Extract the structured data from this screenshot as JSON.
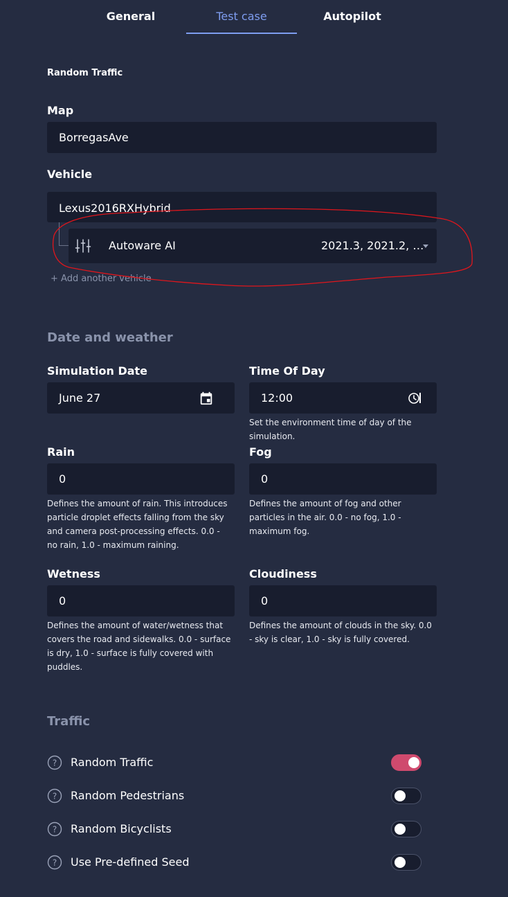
{
  "tabs": [
    "General",
    "Test case",
    "Autopilot"
  ],
  "active_tab": "Test case",
  "random_traffic_title": "Random Traffic",
  "map": {
    "label": "Map",
    "value": "BorregasAve"
  },
  "vehicle": {
    "label": "Vehicle",
    "value": "Lexus2016RXHybrid",
    "sensor": {
      "name": "Autoware AI",
      "versions": "2021.3, 2021.2, 20..."
    },
    "add_label": "+ Add another vehicle"
  },
  "date_weather": {
    "title": "Date and weather",
    "simulation_date": {
      "label": "Simulation Date",
      "value": "June 27"
    },
    "time_of_day": {
      "label": "Time Of Day",
      "value": "12:00",
      "help": "Set the environment time of day of the simulation."
    },
    "rain": {
      "label": "Rain",
      "value": "0",
      "help": "Defines the amount of rain. This introduces particle droplet effects falling from the sky and camera post-processing effects. 0.0 - no rain, 1.0 - maximum raining."
    },
    "fog": {
      "label": "Fog",
      "value": "0",
      "help": "Defines the amount of fog and other particles in the air. 0.0 - no fog, 1.0 - maximum fog."
    },
    "wetness": {
      "label": "Wetness",
      "value": "0",
      "help": "Defines the amount of water/wetness that covers the road and sidewalks. 0.0 - surface is dry, 1.0 - surface is fully covered with puddles."
    },
    "cloudiness": {
      "label": "Cloudiness",
      "value": "0",
      "help": "Defines the amount of clouds in the sky. 0.0 - sky is clear, 1.0 - sky is fully covered."
    }
  },
  "traffic": {
    "title": "Traffic",
    "options": [
      {
        "label": "Random Traffic",
        "enabled": true
      },
      {
        "label": "Random Pedestrians",
        "enabled": false
      },
      {
        "label": "Random Bicyclists",
        "enabled": false
      },
      {
        "label": "Use Pre-defined Seed",
        "enabled": false
      }
    ]
  },
  "colors": {
    "background": "#252c41",
    "field": "#181d2e",
    "accent": "#7e9df0",
    "toggle_on": "#cf4a6e",
    "annotation": "#e0161c"
  },
  "icons": [
    "sliders-icon",
    "calendar-icon",
    "clock-icon",
    "help-circle-icon",
    "chevron-down-icon"
  ]
}
